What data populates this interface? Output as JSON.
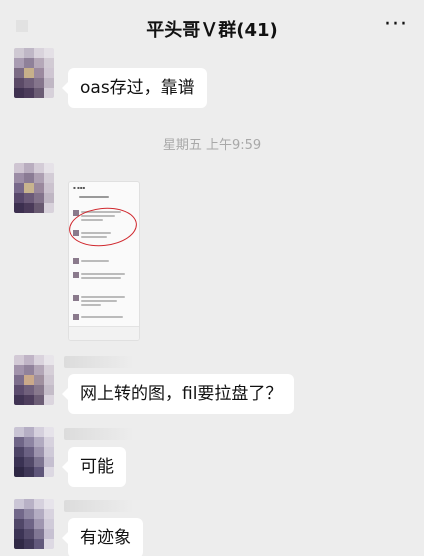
{
  "header": {
    "title": "平头哥Ｖ群(41)",
    "more_label": "···"
  },
  "timestamp": "星期五 上午9:59",
  "messages": [
    {
      "text": "oas存过，靠谱"
    },
    {
      "text": "网上转的图，fil要拉盘了？"
    },
    {
      "text": "可能"
    },
    {
      "text": "有迹象"
    }
  ],
  "colors": {
    "background": "#ededed",
    "bubble": "#ffffff",
    "annotation_circle": "#d0282e"
  }
}
